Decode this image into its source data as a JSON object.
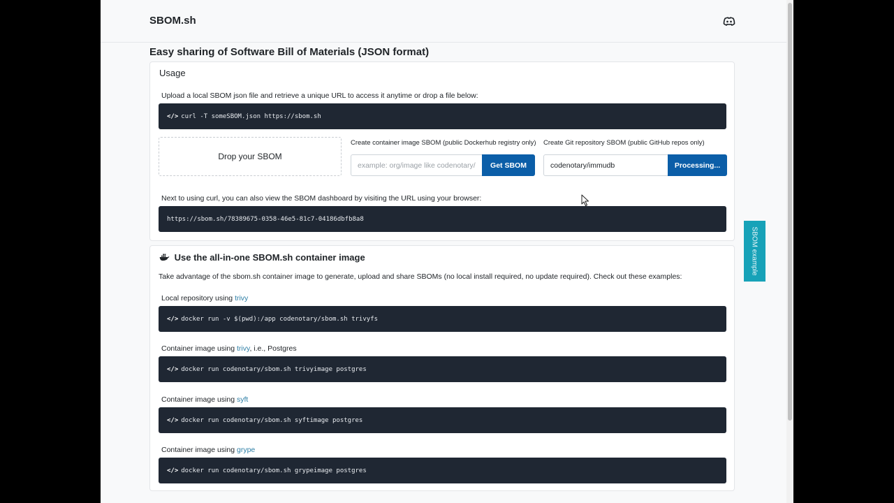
{
  "header": {
    "brand": "SBOM.sh",
    "discord_icon": "discord-icon"
  },
  "headline": "Easy sharing of Software Bill of Materials (JSON format)",
  "usage": {
    "title": "Usage",
    "upload_text": "Upload a local SBOM json file and retrieve a unique URL to access it anytime or drop a file below:",
    "curl_command": "curl -T someSBOM.json https://sbom.sh",
    "drop_label": "Drop your SBOM",
    "container": {
      "label": "Create container image SBOM (public Dockerhub registry only)",
      "placeholder": "example: org/image like codenotary/sbom.sh",
      "value": "",
      "button": "Get SBOM"
    },
    "git": {
      "label": "Create Git repository SBOM (public GitHub repos only)",
      "value": "codenotary/immudb",
      "button": "Processing..."
    },
    "dashboard_text": "Next to using curl, you can also view the SBOM dashboard by visiting the URL using your browser:",
    "dashboard_url": "https://sbom.sh/78389675-0358-46e5-81c7-04186dbfb8a8"
  },
  "container_section": {
    "title": "Use the all-in-one SBOM.sh container image",
    "title_icon": "docker-whale-icon",
    "intro": "Take advantage of the sbom.sh container image to generate, upload and share SBOMs (no local install required, no update required). Check out these examples:",
    "examples": [
      {
        "prefix": "Local repository using ",
        "tool": "trivy",
        "suffix": "",
        "command": "docker run -v $(pwd):/app codenotary/sbom.sh trivyfs"
      },
      {
        "prefix": "Container image using ",
        "tool": "trivy",
        "suffix": ", i.e., Postgres",
        "command": "docker run codenotary/sbom.sh trivyimage postgres"
      },
      {
        "prefix": "Container image using ",
        "tool": "syft",
        "suffix": "",
        "command": "docker run codenotary/sbom.sh syftimage postgres"
      },
      {
        "prefix": "Container image using ",
        "tool": "grype",
        "suffix": "",
        "command": "docker run codenotary/sbom.sh grypeimage postgres"
      }
    ]
  },
  "side_tab": {
    "label": "SBOM example"
  },
  "code_icon": "</>",
  "colors": {
    "primary_button": "#0b5ea8",
    "code_background": "#1f2733",
    "side_tab": "#17a2b8",
    "link": "#2e7fa6"
  }
}
